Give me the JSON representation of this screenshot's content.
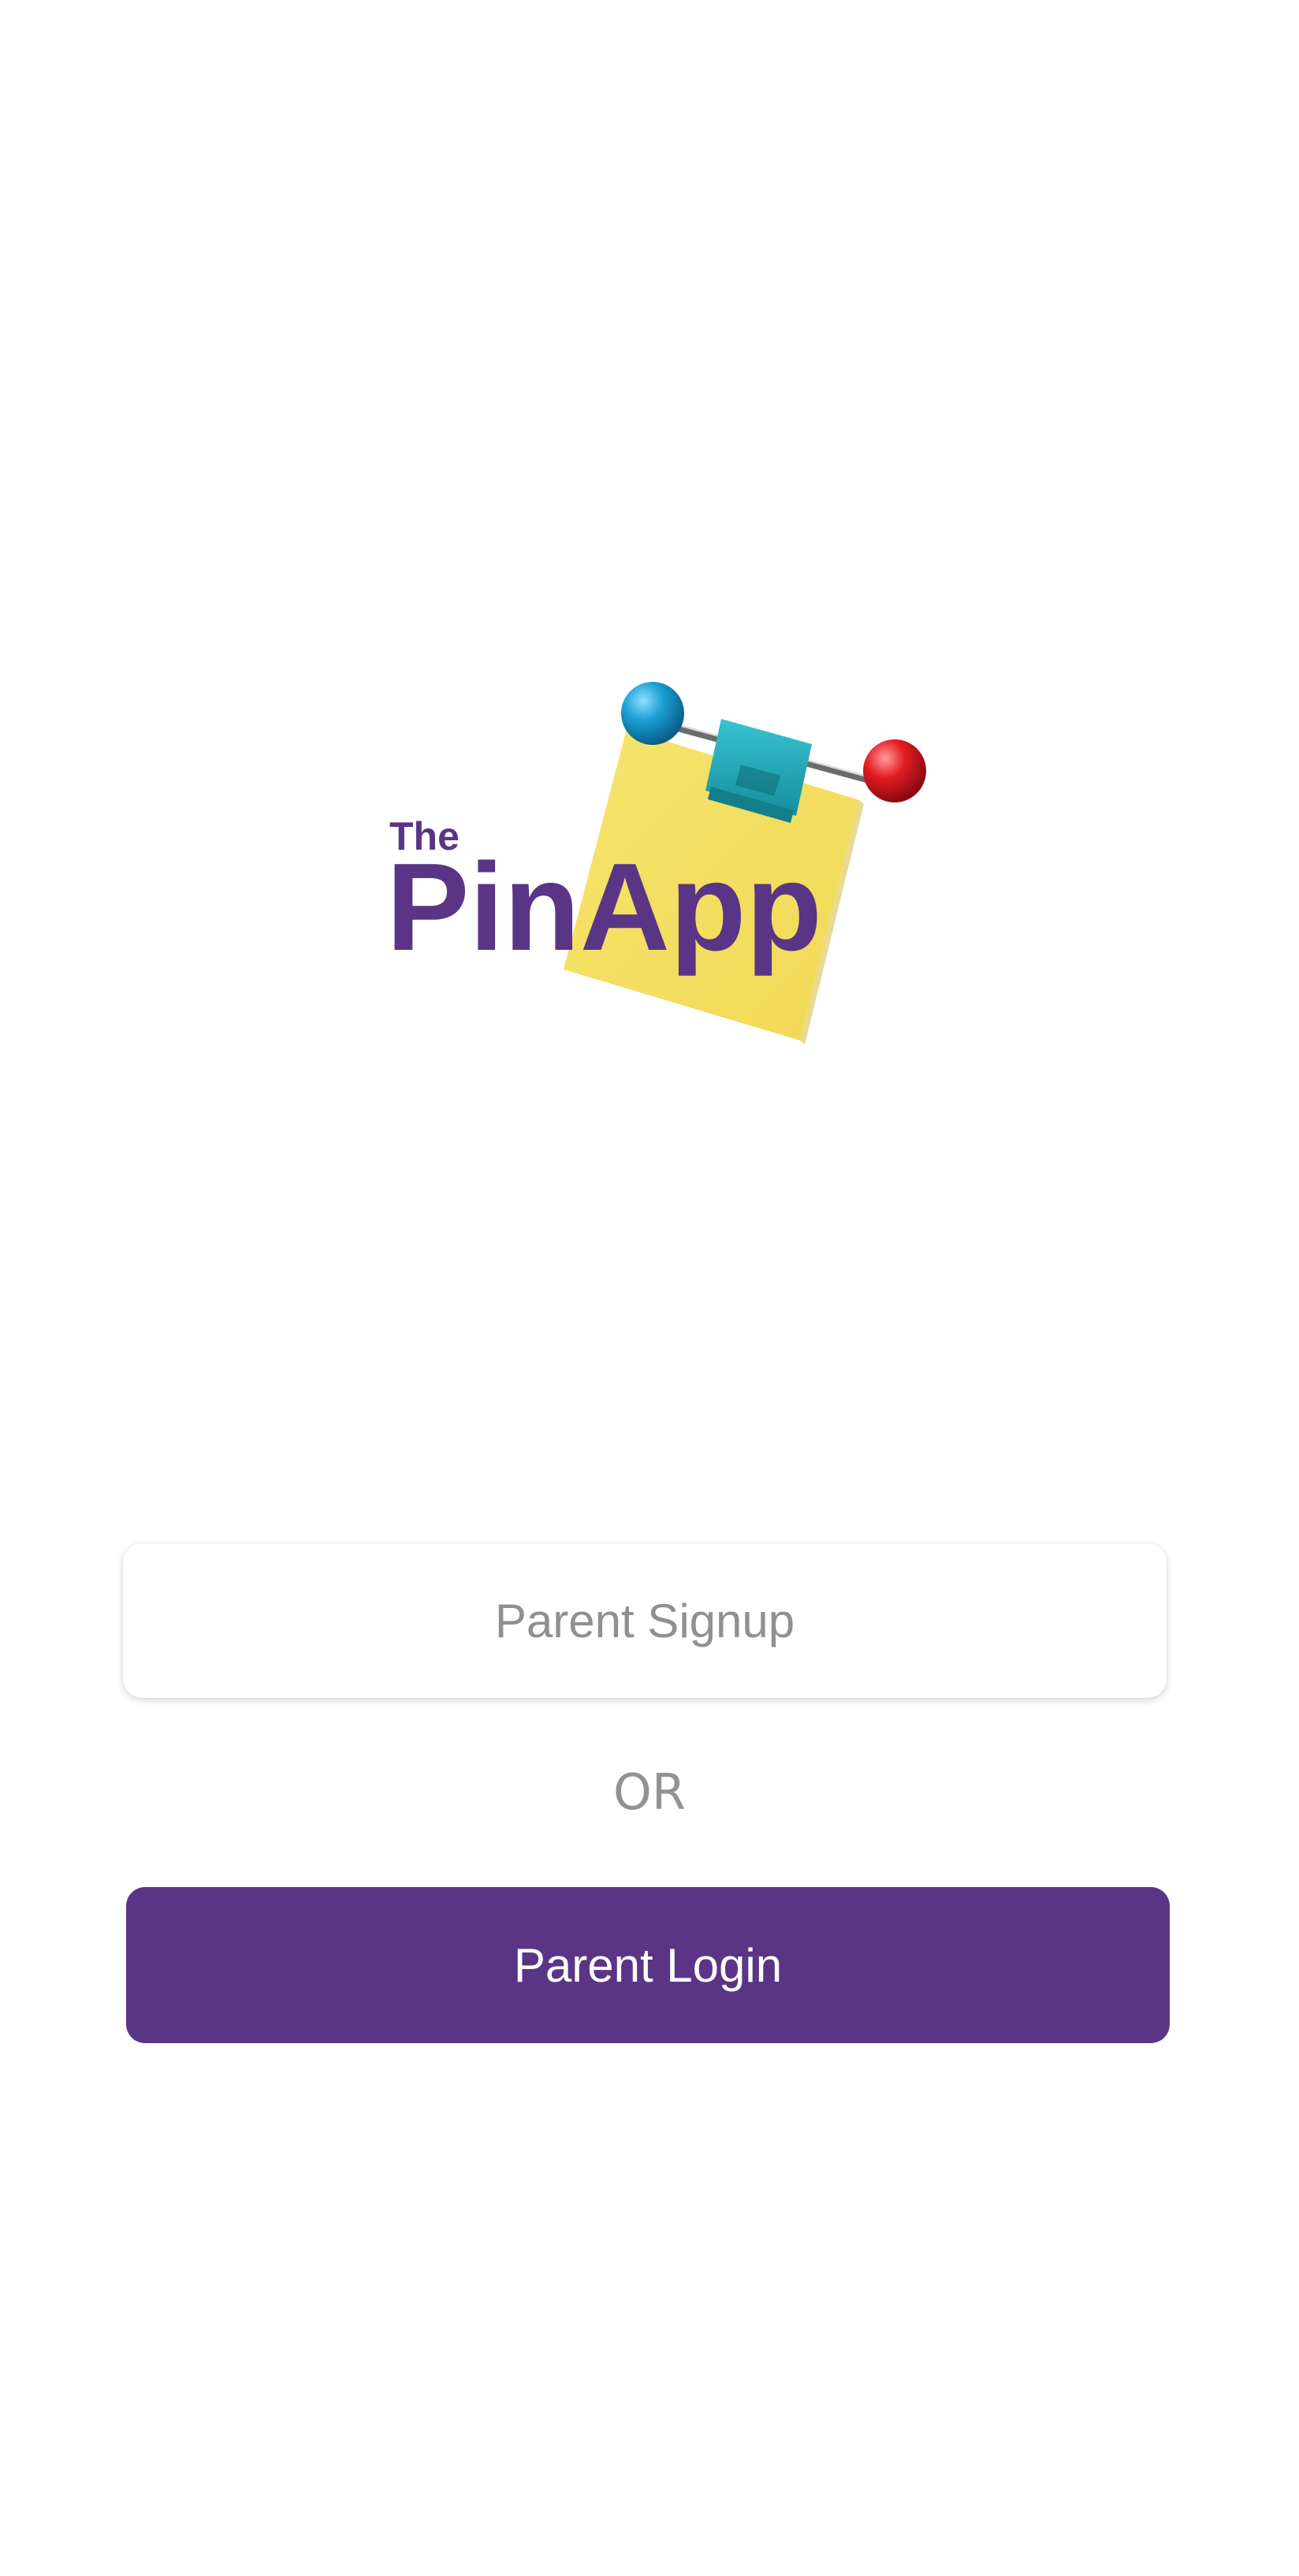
{
  "logo": {
    "the": "The",
    "name": "PinApp",
    "brand_color": "#5a3585",
    "note_color": "#f4e063",
    "clip_color": "#1fa7b8",
    "pin_left_color": "#1c9fd4",
    "pin_right_color": "#e31b23",
    "icons": [
      "push-pin-icon",
      "binder-clip-icon",
      "sticky-note-icon"
    ]
  },
  "actions": {
    "signup_label": "Parent Signup",
    "or_label": "OR",
    "login_label": "Parent Login"
  },
  "colors": {
    "background": "#ffffff",
    "primary": "#5a3585",
    "muted_text": "#929292"
  }
}
